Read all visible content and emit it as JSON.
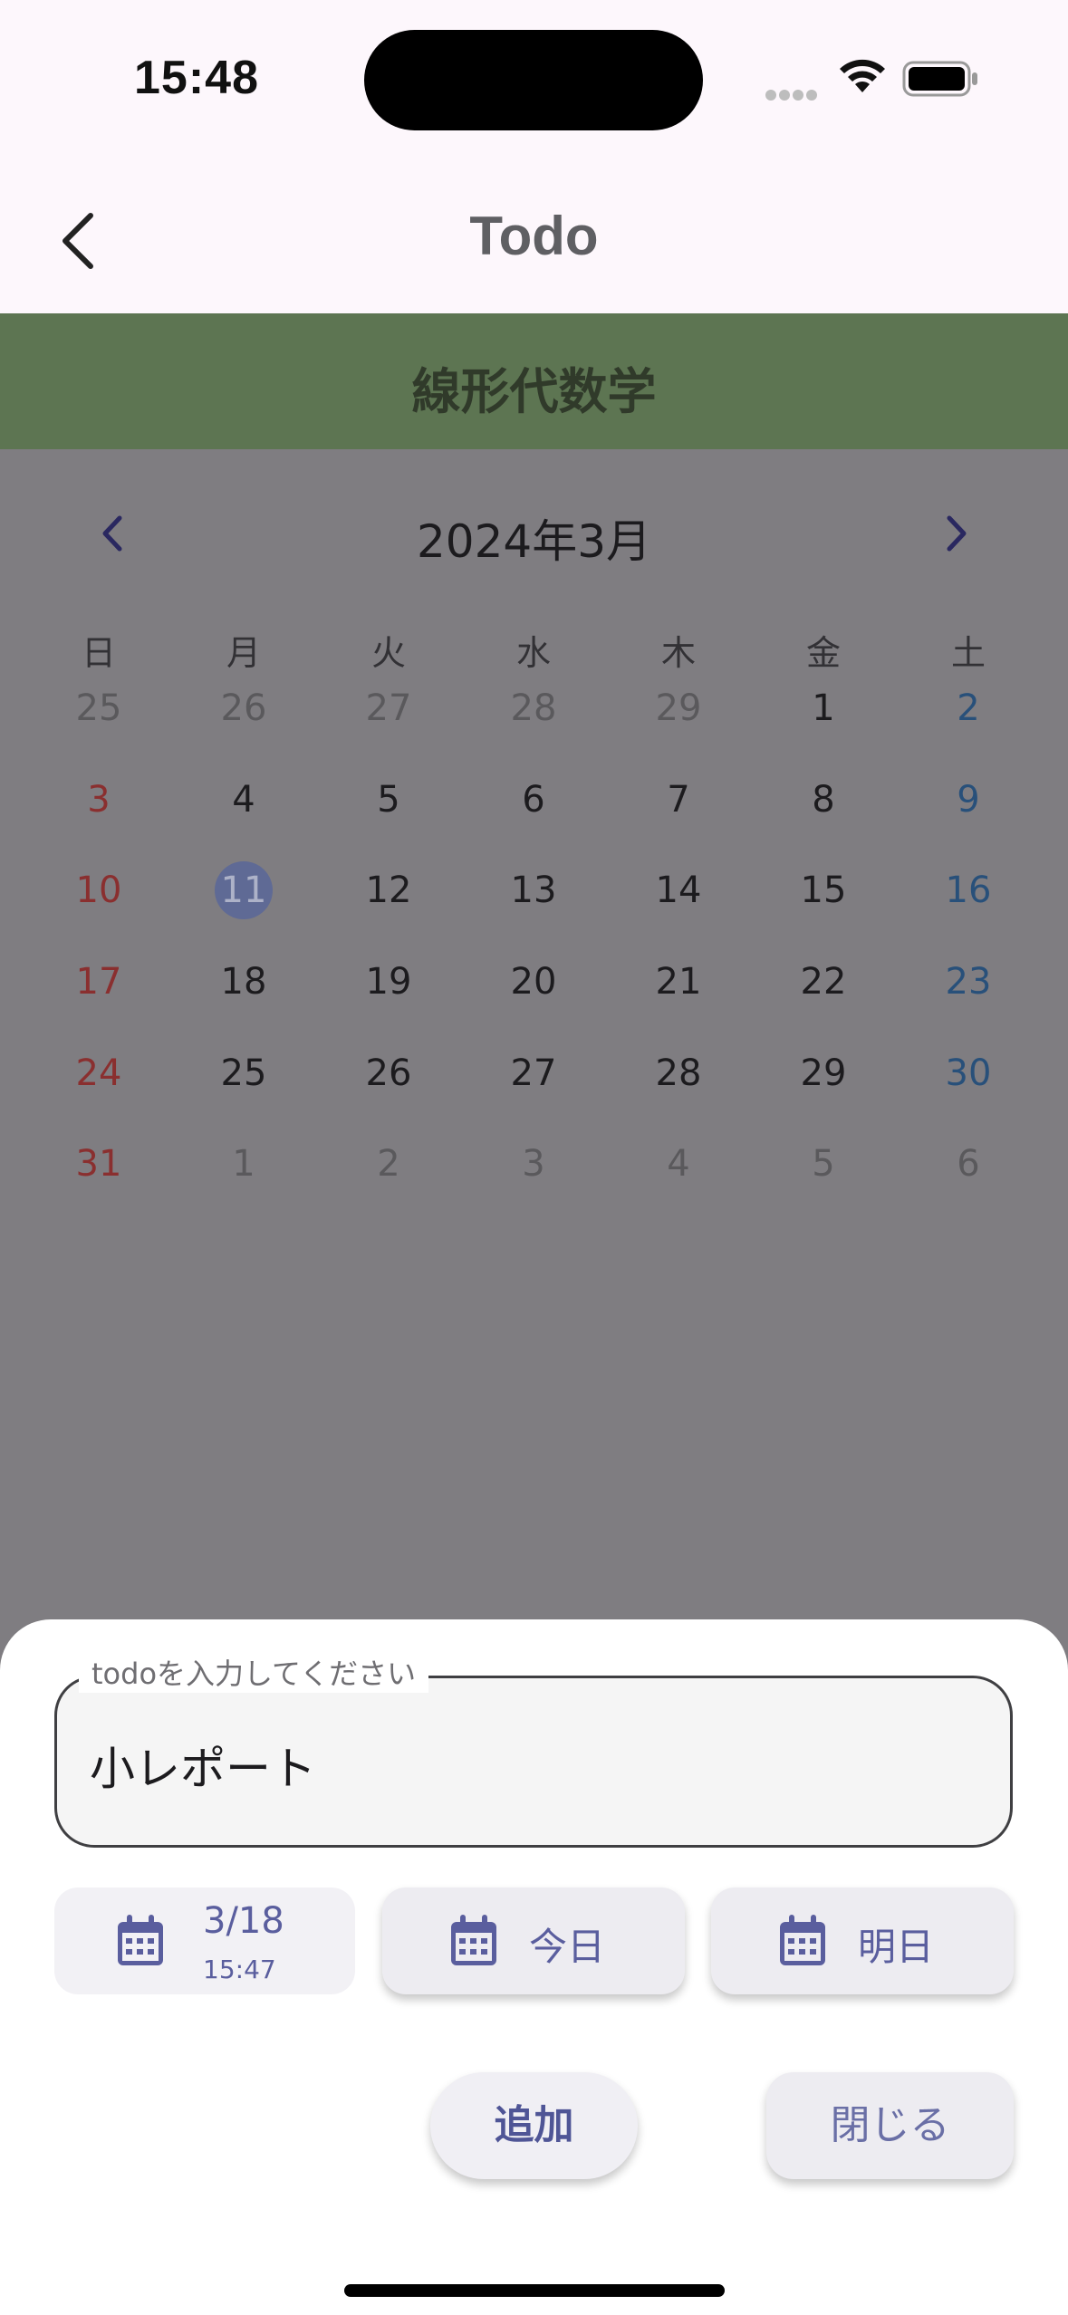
{
  "status_bar": {
    "time": "15:48"
  },
  "app_bar": {
    "title": "Todo",
    "back_icon": "chevron-left-icon"
  },
  "subject": {
    "title": "線形代数学",
    "color": "#5d7552"
  },
  "calendar": {
    "month_label": "2024年3月",
    "weekdays": [
      "日",
      "月",
      "火",
      "水",
      "木",
      "金",
      "土"
    ],
    "days": [
      {
        "label": "25",
        "type": "out"
      },
      {
        "label": "26",
        "type": "out"
      },
      {
        "label": "27",
        "type": "out"
      },
      {
        "label": "28",
        "type": "out"
      },
      {
        "label": "29",
        "type": "out"
      },
      {
        "label": "1",
        "type": "normal"
      },
      {
        "label": "2",
        "type": "sat"
      },
      {
        "label": "3",
        "type": "sun"
      },
      {
        "label": "4",
        "type": "normal"
      },
      {
        "label": "5",
        "type": "normal"
      },
      {
        "label": "6",
        "type": "normal"
      },
      {
        "label": "7",
        "type": "normal"
      },
      {
        "label": "8",
        "type": "normal"
      },
      {
        "label": "9",
        "type": "sat"
      },
      {
        "label": "10",
        "type": "sun"
      },
      {
        "label": "11",
        "type": "today"
      },
      {
        "label": "12",
        "type": "normal"
      },
      {
        "label": "13",
        "type": "normal"
      },
      {
        "label": "14",
        "type": "normal"
      },
      {
        "label": "15",
        "type": "normal"
      },
      {
        "label": "16",
        "type": "sat"
      },
      {
        "label": "17",
        "type": "sun"
      },
      {
        "label": "18",
        "type": "normal"
      },
      {
        "label": "19",
        "type": "normal"
      },
      {
        "label": "20",
        "type": "normal"
      },
      {
        "label": "21",
        "type": "normal"
      },
      {
        "label": "22",
        "type": "normal"
      },
      {
        "label": "23",
        "type": "sat"
      },
      {
        "label": "24",
        "type": "sun"
      },
      {
        "label": "25",
        "type": "normal"
      },
      {
        "label": "26",
        "type": "normal"
      },
      {
        "label": "27",
        "type": "normal"
      },
      {
        "label": "28",
        "type": "normal"
      },
      {
        "label": "29",
        "type": "normal"
      },
      {
        "label": "30",
        "type": "sat"
      },
      {
        "label": "31",
        "type": "sun"
      },
      {
        "label": "1",
        "type": "out"
      },
      {
        "label": "2",
        "type": "out"
      },
      {
        "label": "3",
        "type": "out"
      },
      {
        "label": "4",
        "type": "out"
      },
      {
        "label": "5",
        "type": "out"
      },
      {
        "label": "6",
        "type": "out"
      }
    ]
  },
  "sheet": {
    "todo_label": "todoを入力してください",
    "todo_value": "小レポート",
    "date_chip": {
      "date": "3/18",
      "time": "15:47"
    },
    "today_label": "今日",
    "tomorrow_label": "明日",
    "add_label": "追加",
    "close_label": "閉じる"
  }
}
